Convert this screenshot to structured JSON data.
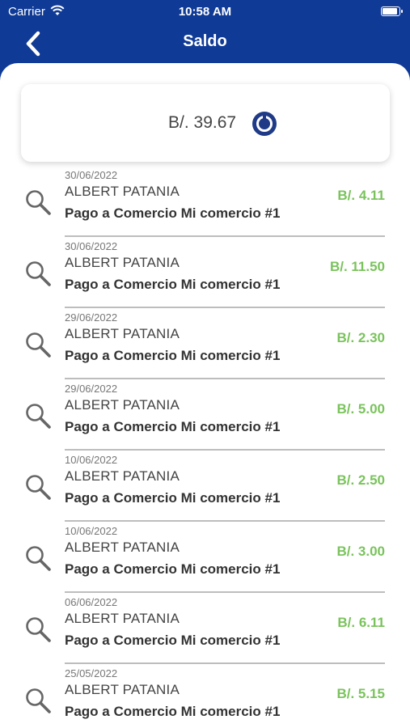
{
  "status_bar": {
    "carrier": "Carrier",
    "time": "10:58 AM",
    "battery_level": 0.95
  },
  "header": {
    "title": "Saldo",
    "back_icon": "chevron-left-icon"
  },
  "balance": {
    "amount": "B/. 39.67",
    "refresh_icon": "refresh-icon"
  },
  "colors": {
    "primary": "#0f3a96",
    "amount_green": "#7ac35c"
  },
  "transactions": [
    {
      "date": "30/06/2022",
      "name": "ALBERT PATANIA",
      "description": "Pago a Comercio Mi comercio #1",
      "amount": "B/. 4.11"
    },
    {
      "date": "30/06/2022",
      "name": "ALBERT PATANIA",
      "description": "Pago a Comercio Mi comercio #1",
      "amount": "B/. 11.50"
    },
    {
      "date": "29/06/2022",
      "name": "ALBERT PATANIA",
      "description": "Pago a Comercio Mi comercio #1",
      "amount": "B/. 2.30"
    },
    {
      "date": "29/06/2022",
      "name": "ALBERT PATANIA",
      "description": "Pago a Comercio Mi comercio #1",
      "amount": "B/. 5.00"
    },
    {
      "date": "10/06/2022",
      "name": "ALBERT PATANIA",
      "description": "Pago a Comercio Mi comercio #1",
      "amount": "B/. 2.50"
    },
    {
      "date": "10/06/2022",
      "name": "ALBERT PATANIA",
      "description": "Pago a Comercio Mi comercio #1",
      "amount": "B/. 3.00"
    },
    {
      "date": "06/06/2022",
      "name": "ALBERT PATANIA",
      "description": "Pago a Comercio Mi comercio #1",
      "amount": "B/. 6.11"
    },
    {
      "date": "25/05/2022",
      "name": "ALBERT PATANIA",
      "description": "Pago a Comercio Mi comercio #1",
      "amount": "B/. 5.15"
    }
  ]
}
